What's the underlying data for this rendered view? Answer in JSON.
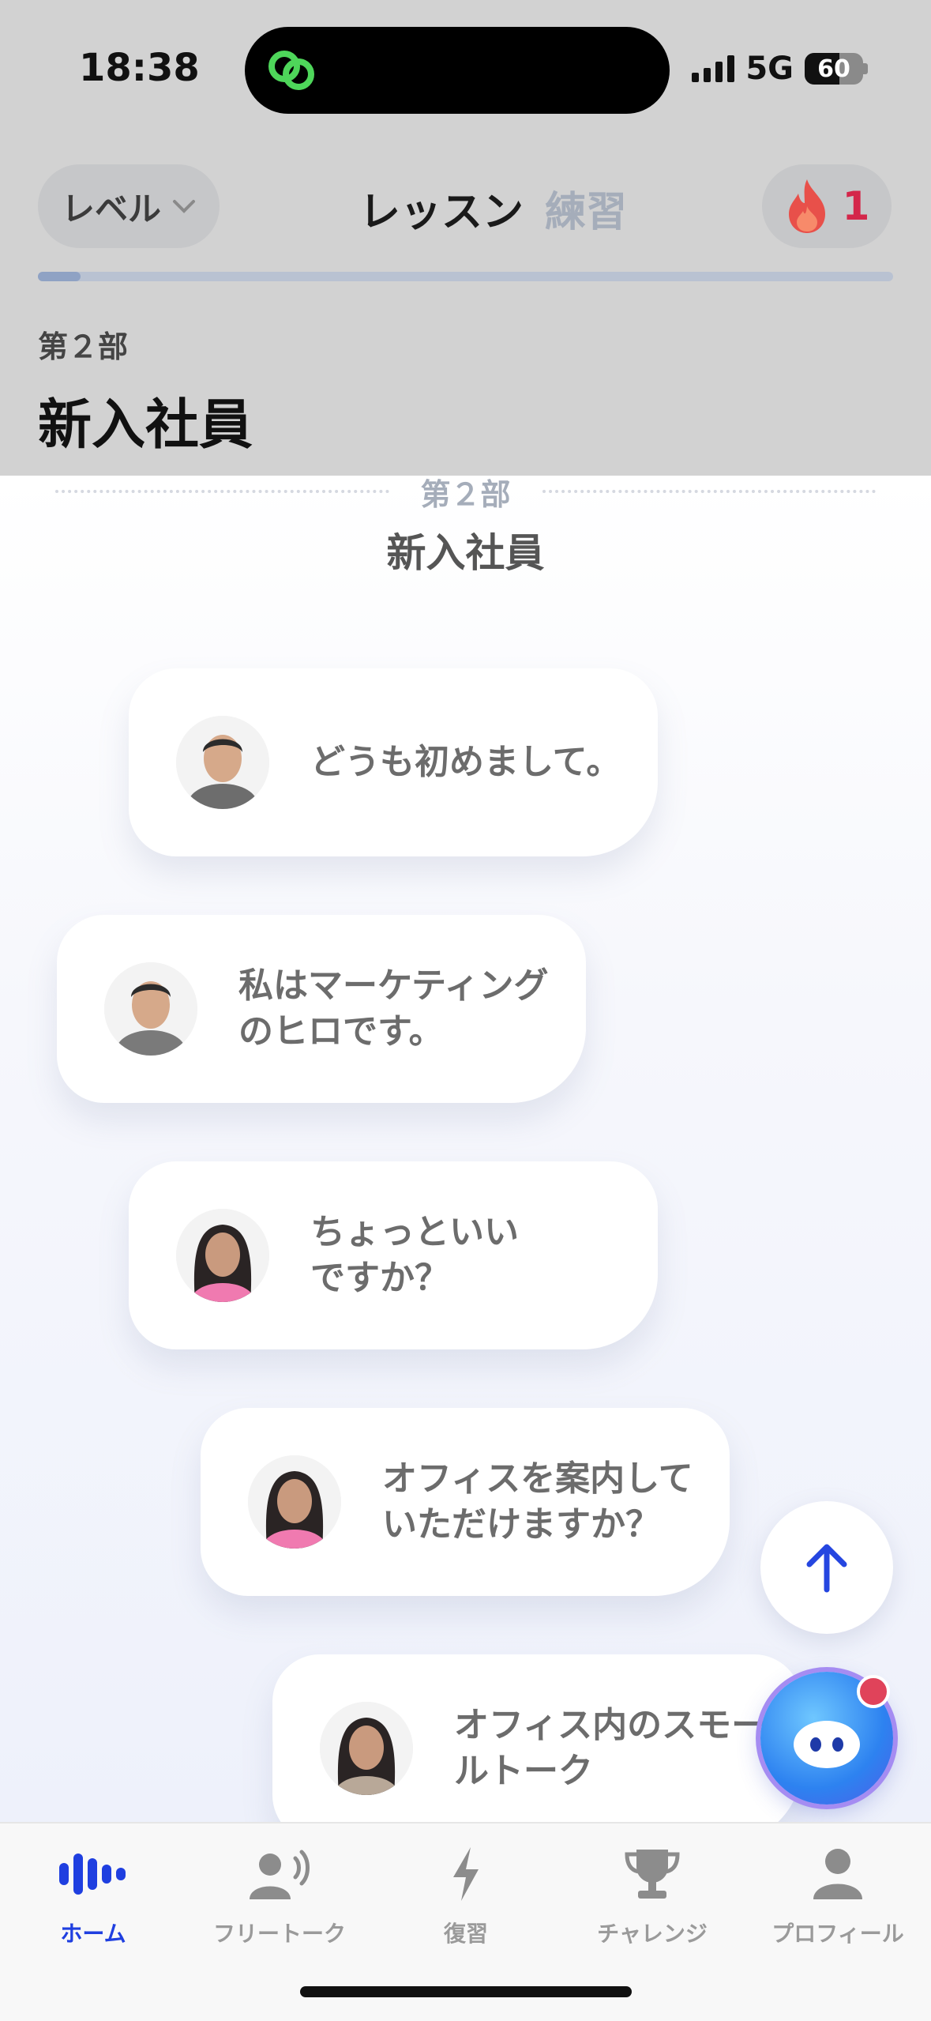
{
  "status_bar": {
    "time": "18:38",
    "network": "5G",
    "battery": "60",
    "battery_level": 0.6
  },
  "header": {
    "level_label": "レベル",
    "tabs": [
      {
        "label": "レッスン",
        "active": true
      },
      {
        "label": "練習",
        "active": false
      }
    ],
    "streak_count": "1",
    "progress": 0.05,
    "part_label": "第２部",
    "part_title": "新入社員"
  },
  "section": {
    "label": "第２部",
    "title": "新入社員"
  },
  "lessons": [
    {
      "text": "どうも初めまして。",
      "avatar": "man-smiling"
    },
    {
      "text": "私はマーケティング\nのヒロです。",
      "avatar": "man"
    },
    {
      "text": "ちょっといい\nですか？",
      "avatar": "woman"
    },
    {
      "text": "オフィスを案内して\nいただけますか？",
      "avatar": "woman"
    },
    {
      "text": "オフィス内のスモー\nルトーク",
      "avatar": "woman"
    }
  ],
  "tabbar": [
    {
      "label": "ホーム",
      "icon": "waveform-icon",
      "active": true
    },
    {
      "label": "フリートーク",
      "icon": "speaking-person-icon",
      "active": false
    },
    {
      "label": "復習",
      "icon": "lightning-icon",
      "active": false
    },
    {
      "label": "チャレンジ",
      "icon": "trophy-icon",
      "active": false
    },
    {
      "label": "プロフィール",
      "icon": "person-icon",
      "active": false
    }
  ],
  "colors": {
    "accent": "#1f3fe0",
    "streak": "#d4264a",
    "header_bg": "#d2d2d2"
  }
}
